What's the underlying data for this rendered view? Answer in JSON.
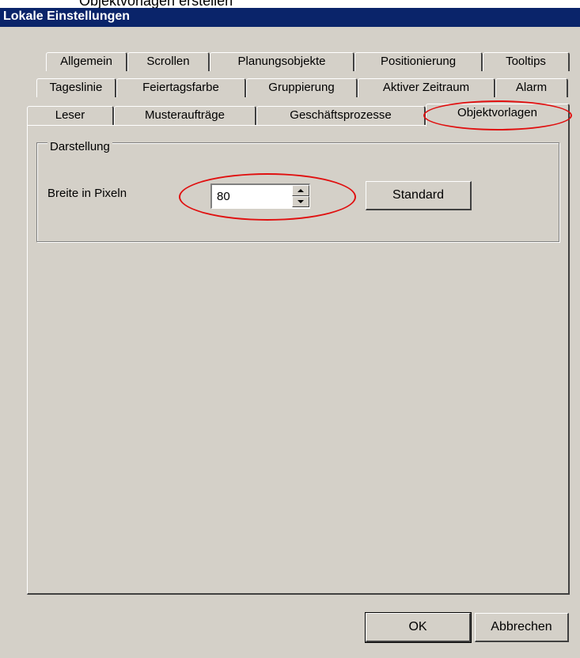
{
  "top_fragment": "Objektvorlagen erstellen",
  "window": {
    "title": "Lokale Einstellungen"
  },
  "tabs": {
    "row1": [
      "Allgemein",
      "Scrollen",
      "Planungsobjekte",
      "Positionierung",
      "Tooltips"
    ],
    "row2": [
      "Tageslinie",
      "Feiertagsfarbe",
      "Gruppierung",
      "Aktiver Zeitraum",
      "Alarm"
    ],
    "row3": [
      "Leser",
      "Musteraufträge",
      "Geschäftsprozesse",
      "Objektvorlagen"
    ],
    "active": "Objektvorlagen"
  },
  "group": {
    "title": "Darstellung"
  },
  "width_field": {
    "label": "Breite in Pixeln",
    "value": "80"
  },
  "buttons": {
    "standard": "Standard",
    "ok": "OK",
    "cancel": "Abbrechen"
  },
  "colors": {
    "titlebar": "#0a246a",
    "face": "#d4d0c8",
    "highlight_ellipse": "#e01010"
  }
}
